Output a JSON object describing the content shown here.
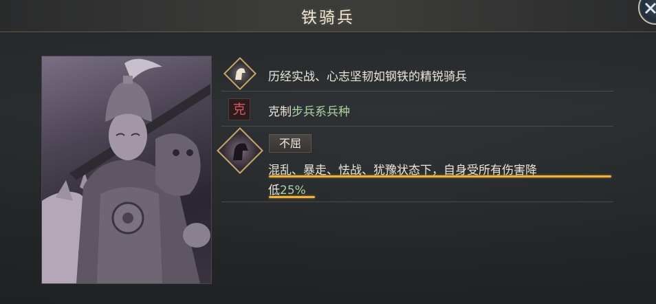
{
  "header": {
    "title": "铁骑兵"
  },
  "rows": {
    "description": "历经实战、心志坚韧如钢铁的精锐骑兵",
    "counter_badge": "克",
    "counter_prefix": "克制",
    "counter_target": "步兵系兵种",
    "skill_name": "不屈",
    "skill_desc_line1": "混乱、暴走、怯战、犹豫状态下，自身受所有伤害降",
    "skill_desc_line2_prefix": "低",
    "skill_desc_value": "25%"
  },
  "colors": {
    "accent_gold": "#c7a868",
    "highlight_green": "#a9d6a2",
    "underline_orange": "#f0b43a",
    "counter_red": "#d65a5a"
  },
  "icons": [
    "close-icon",
    "horse-head-icon",
    "dark-horse-icon"
  ]
}
